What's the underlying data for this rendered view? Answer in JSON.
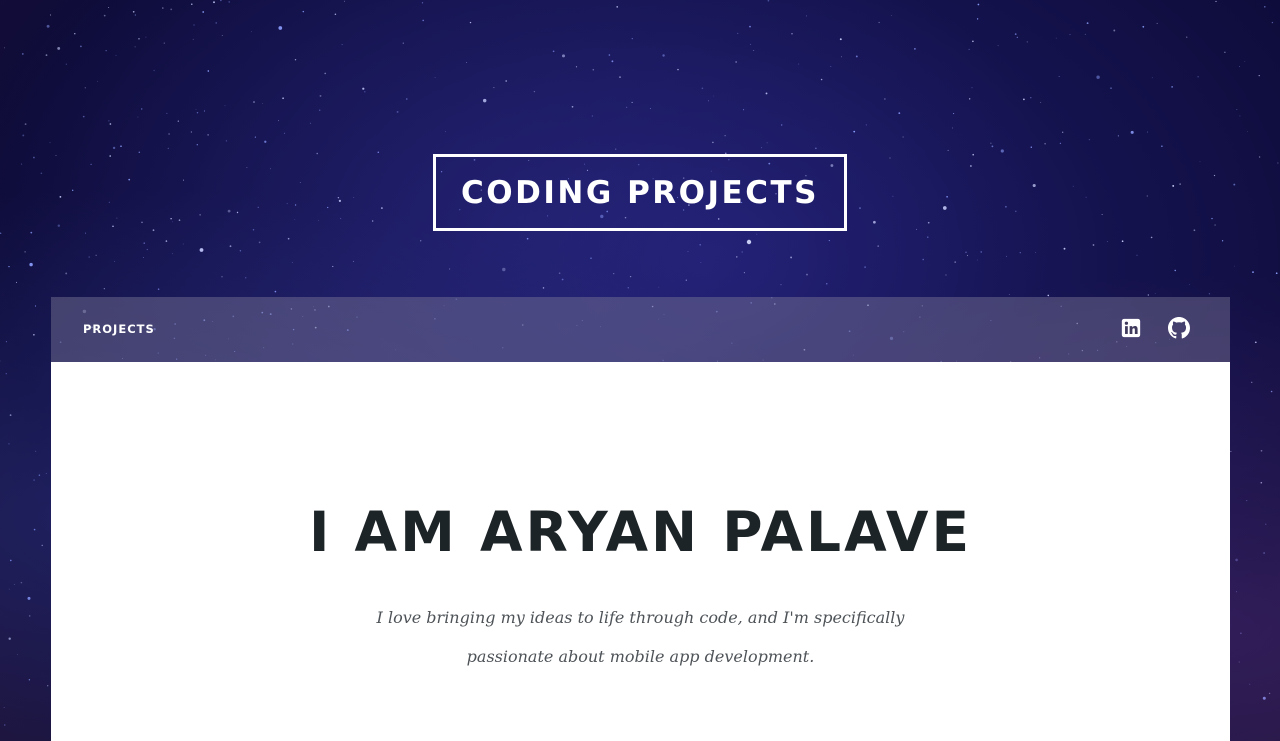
{
  "site": {
    "title": "CODING PROJECTS"
  },
  "nav": {
    "links": [
      {
        "label": "PROJECTS"
      }
    ],
    "social": [
      {
        "icon": "linkedin-icon"
      },
      {
        "icon": "github-icon"
      }
    ]
  },
  "hero": {
    "heading": "I AM ARYAN PALAVE",
    "intro": "I love bringing my ideas to life through code, and I'm specifically passionate about mobile app development."
  },
  "colors": {
    "background": "#15134f",
    "nav_bar": "#5b5672",
    "panel": "#ffffff",
    "heading_text": "#1d2427",
    "body_text": "#4e5358"
  }
}
